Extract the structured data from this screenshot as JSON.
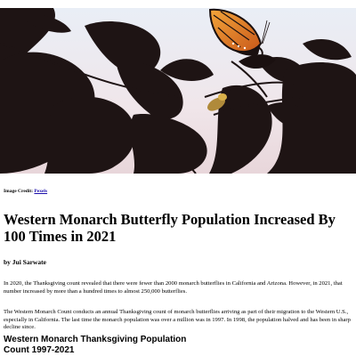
{
  "hero": {
    "image": "monarch-butterfly-on-leaves-photo"
  },
  "credit": {
    "prefix": "Image Credit: ",
    "link_text": "Pexels"
  },
  "article": {
    "headline": "Western Monarch Butterfly Population Increased By 100 Times in 2021",
    "byline": "by Jui Sarwate",
    "paragraphs": [
      "In 2020, the Thanksgiving count revealed that there were fewer than 2000 monarch butterflies in California and Arizona. However, in 2021, that number increased by more than a hundred times to almost 250,000 butterflies.",
      "The Western Monarch Count conducts an annual Thanksgiving count of monarch butterflies arriving as part of their migration to the Western U.S., especially in California. The last time the monarch population was over a million was in 1997. In 1998, the population halved and has been in sharp decline since."
    ],
    "chart_title_line1": "Western Monarch Thanksgiving Population",
    "chart_title_line2": "Count 1997-2021"
  }
}
